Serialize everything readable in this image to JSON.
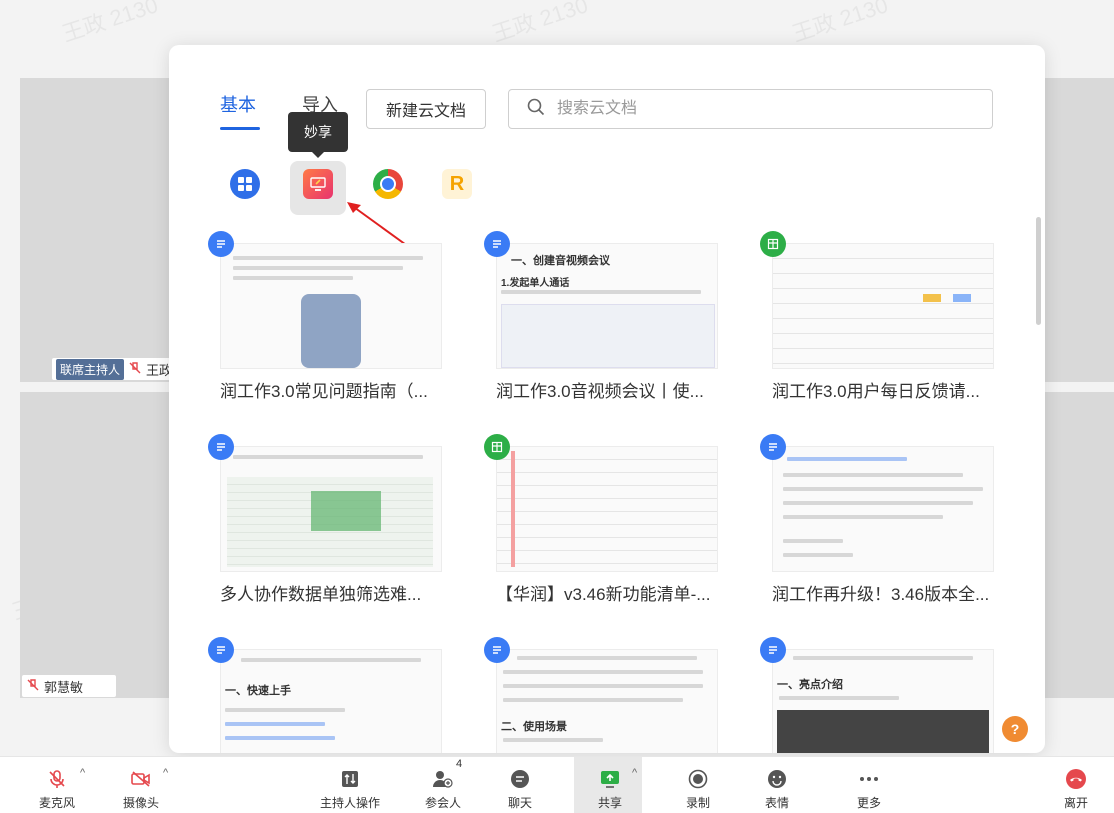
{
  "watermark": "王政 2130",
  "participants": [
    {
      "role_badge": "联席主持人",
      "name": "王政"
    },
    {
      "name": "郭慧敏"
    }
  ],
  "panel": {
    "tabs": [
      {
        "label": "基本",
        "active": true
      },
      {
        "label": "导入",
        "active": false
      }
    ],
    "new_button_label": "新建云文档",
    "search_placeholder": "搜索云文档",
    "tooltip": "妙享",
    "apps": [
      {
        "name": "apps-grid-icon",
        "color": "#2f6fe8"
      },
      {
        "name": "miaoxiang-icon",
        "color": "#f04a6c"
      },
      {
        "name": "chrome-icon",
        "color": "#e8463b"
      },
      {
        "name": "r-app-icon",
        "color": "#f5b700"
      }
    ],
    "documents": [
      {
        "title": "润工作3.0常见问题指南（...",
        "type": "doc"
      },
      {
        "title": "润工作3.0音视频会议丨使...",
        "type": "doc"
      },
      {
        "title": "润工作3.0用户每日反馈请...",
        "type": "sheet"
      },
      {
        "title": "多人协作数据单独筛选难...",
        "type": "doc"
      },
      {
        "title": "【华润】v3.46新功能清单-...",
        "type": "sheet"
      },
      {
        "title": "润工作再升级！3.46版本全...",
        "type": "doc"
      },
      {
        "title": "",
        "type": "doc"
      },
      {
        "title": "",
        "type": "doc"
      },
      {
        "title": "",
        "type": "doc"
      }
    ],
    "thumb_texts": {
      "doc2_heading": "一、创建音视频会议",
      "doc2_sub": "1.发起单人通话",
      "doc7_section": "一、快速上手",
      "doc8_section": "二、使用场景",
      "doc9_section": "一、亮点介绍"
    },
    "help_label": "?"
  },
  "toolbar": {
    "mic": "麦克风",
    "camera": "摄像头",
    "host_ops": "主持人操作",
    "participants": "参会人",
    "participants_count": "4",
    "chat": "聊天",
    "share": "共享",
    "record": "录制",
    "emoji": "表情",
    "more": "更多",
    "leave": "离开"
  },
  "colors": {
    "accent": "#1f64e0",
    "danger": "#e5484d",
    "share": "#2dae47"
  }
}
